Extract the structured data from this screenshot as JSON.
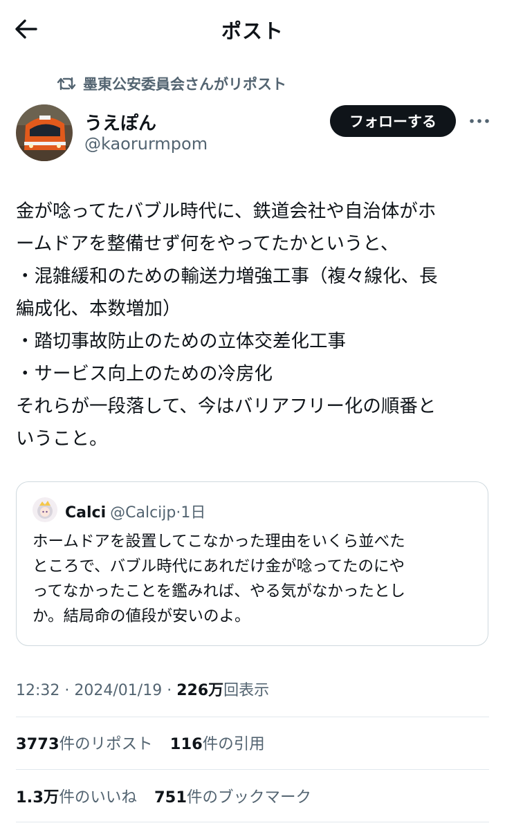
{
  "header": {
    "title": "ポスト"
  },
  "repost": {
    "label": "墨東公安委員会さんがリポスト"
  },
  "author": {
    "name": "うえぽん",
    "handle": "@kaorurmpom",
    "follow_label": "フォローする"
  },
  "post": {
    "lines": [
      "金が唸ってたバブル時代に、鉄道会社や自治体がホ",
      "ームドアを整備せず何をやってたかというと、",
      "・混雑緩和のための輸送力増強工事（複々線化、長",
      "編成化、本数増加）",
      "・踏切事故防止のための立体交差化工事",
      "・サービス向上のための冷房化",
      "それらが一段落して、今はバリアフリー化の順番と",
      "いうこと。"
    ]
  },
  "quote": {
    "name": "Calci",
    "handle": "@Calcijp",
    "time": "1日",
    "lines": [
      "ホームドアを設置してこなかった理由をいくら並べた",
      "ところで、バブル時代にあれだけ金が唸ってたのにや",
      "ってなかったことを鑑みれば、やる気がなかったとし",
      "か。結局命の値段が安いのよ。"
    ]
  },
  "meta": {
    "time": "12:32",
    "date": "2024/01/19",
    "views": "226万",
    "views_label": "回表示"
  },
  "stats": {
    "reposts": "3773",
    "reposts_label": "件のリポスト",
    "quotes": "116",
    "quotes_label": "件の引用",
    "likes": "1.3万",
    "likes_label": "件のいいね",
    "bookmarks": "751",
    "bookmarks_label": "件のブックマーク"
  }
}
